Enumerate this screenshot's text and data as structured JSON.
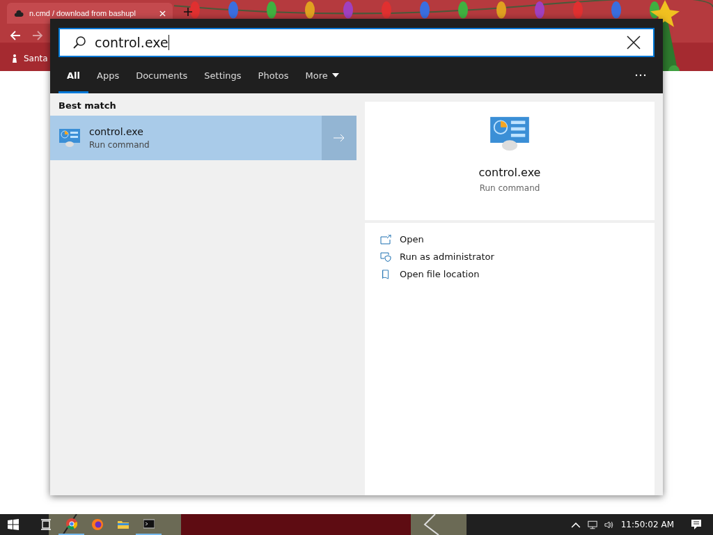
{
  "browser": {
    "tab_title": "n.cmd / download from bashupl",
    "bookmark": "Santa"
  },
  "search": {
    "query": "control.exe",
    "tabs": [
      {
        "label": "All",
        "selected": true
      },
      {
        "label": "Apps",
        "selected": false
      },
      {
        "label": "Documents",
        "selected": false
      },
      {
        "label": "Settings",
        "selected": false
      },
      {
        "label": "Photos",
        "selected": false
      },
      {
        "label": "More",
        "selected": false,
        "kind": "dropdown"
      }
    ],
    "best_match": {
      "heading": "Best match",
      "title": "control.exe",
      "subtitle": "Run command",
      "selected": true
    },
    "preview": {
      "title": "control.exe",
      "subtitle": "Run command"
    },
    "actions": [
      {
        "label": "Open",
        "kind": "open"
      },
      {
        "label": "Run as administrator",
        "kind": "admin"
      },
      {
        "label": "Open file location",
        "kind": "folder"
      }
    ]
  },
  "taskbar": {
    "apps": [
      {
        "kind": "taskview",
        "running": false
      },
      {
        "kind": "chrome",
        "running": true
      },
      {
        "kind": "firefox",
        "running": false
      },
      {
        "kind": "explorer",
        "running": false
      },
      {
        "kind": "terminal",
        "running": true
      }
    ],
    "clock": "11:50:02 AM"
  }
}
